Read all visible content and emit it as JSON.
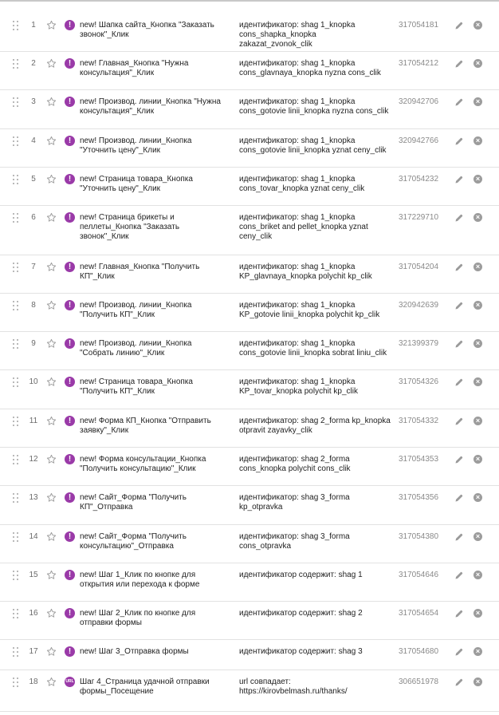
{
  "goals": [
    {
      "num": "1",
      "name": "new! Шапка сайта_Кнопка \"Заказать звонок\"_Клик",
      "condition": "идентификатор: shag 1_knopka cons_shapka_knopka zakazat_zvonok_clik",
      "id": "317054181",
      "badge": "!"
    },
    {
      "num": "2",
      "name": "new! Главная_Кнопка \"Нужна консультация\"_Клик",
      "condition": "идентификатор: shag 1_knopka cons_glavnaya_knopka nyzna cons_clik",
      "id": "317054212",
      "badge": "!"
    },
    {
      "num": "3",
      "name": "new! Производ. линии_Кнопка \"Нужна консультация\"_Клик",
      "condition": "идентификатор: shag 1_knopka cons_gotovie linii_knopka nyzna cons_clik",
      "id": "320942706",
      "badge": "!"
    },
    {
      "num": "4",
      "name": "new! Производ. линии_Кнопка \"Уточнить цену\"_Клик",
      "condition": "идентификатор: shag 1_knopka cons_gotovie linii_knopka yznat ceny_clik",
      "id": "320942766",
      "badge": "!"
    },
    {
      "num": "5",
      "name": "new! Страница товара_Кнопка \"Уточнить цену\"_Клик",
      "condition": "идентификатор: shag 1_knopka cons_tovar_knopka yznat ceny_clik",
      "id": "317054232",
      "badge": "!"
    },
    {
      "num": "6",
      "name": "new! Страница брикеты и пеллеты_Кнопка \"Заказать звонок\"_Клик",
      "condition": "идентификатор: shag 1_knopka cons_briket and pellet_knopka yznat ceny_clik",
      "id": "317229710",
      "badge": "!"
    },
    {
      "num": "7",
      "name": "new! Главная_Кнопка \"Получить КП\"_Клик",
      "condition": "идентификатор: shag 1_knopka KP_glavnaya_knopka polychit kp_clik",
      "id": "317054204",
      "badge": "!"
    },
    {
      "num": "8",
      "name": "new! Производ. линии_Кнопка \"Получить КП\"_Клик",
      "condition": "идентификатор: shag 1_knopka KP_gotovie linii_knopka polychit kp_clik",
      "id": "320942639",
      "badge": "!"
    },
    {
      "num": "9",
      "name": "new! Производ. линии_Кнопка \"Собрать линию\"_Клик",
      "condition": "идентификатор: shag 1_knopka cons_gotovie linii_knopka sobrat liniu_clik",
      "id": "321399379",
      "badge": "!"
    },
    {
      "num": "10",
      "name": "new! Страница товара_Кнопка \"Получить КП\"_Клик",
      "condition": "идентификатор: shag 1_knopka KP_tovar_knopka polychit kp_clik",
      "id": "317054326",
      "badge": "!"
    },
    {
      "num": "11",
      "name": "new! Форма КП_Кнопка \"Отправить заявку\"_Клик",
      "condition": "идентификатор: shag 2_forma kp_knopka otpravit zayavky_clik",
      "id": "317054332",
      "badge": "!"
    },
    {
      "num": "12",
      "name": "new! Форма консультации_Кнопка \"Получить консультацию\"_Клик",
      "condition": "идентификатор: shag 2_forma cons_knopka polychit cons_clik",
      "id": "317054353",
      "badge": "!"
    },
    {
      "num": "13",
      "name": "new! Сайт_Форма \"Получить КП\"_Отправка",
      "condition": "идентификатор: shag 3_forma kp_otpravka",
      "id": "317054356",
      "badge": "!"
    },
    {
      "num": "14",
      "name": "new! Сайт_Форма \"Получить консультацию\"_Отправка",
      "condition": "идентификатор: shag 3_forma cons_otpravka",
      "id": "317054380",
      "badge": "!"
    },
    {
      "num": "15",
      "name": "new! Шаг 1_Клик по кнопке для открытия или перехода к форме",
      "condition": "идентификатор содержит: shag 1",
      "id": "317054646",
      "badge": "!"
    },
    {
      "num": "16",
      "name": "new! Шаг 2_Клик по кнопке для отправки формы",
      "condition": "идентификатор содержит: shag 2",
      "id": "317054654",
      "badge": "!"
    },
    {
      "num": "17",
      "name": "new! Шаг 3_Отправка формы",
      "condition": "идентификатор содержит: shag 3",
      "id": "317054680",
      "badge": "!"
    },
    {
      "num": "18",
      "name": "Шаг 4_Страница удачной отправки формы_Посещение",
      "condition": "url совпадает: https://kirovbelmash.ru/thanks/",
      "id": "306651978",
      "badge": "URL"
    }
  ]
}
